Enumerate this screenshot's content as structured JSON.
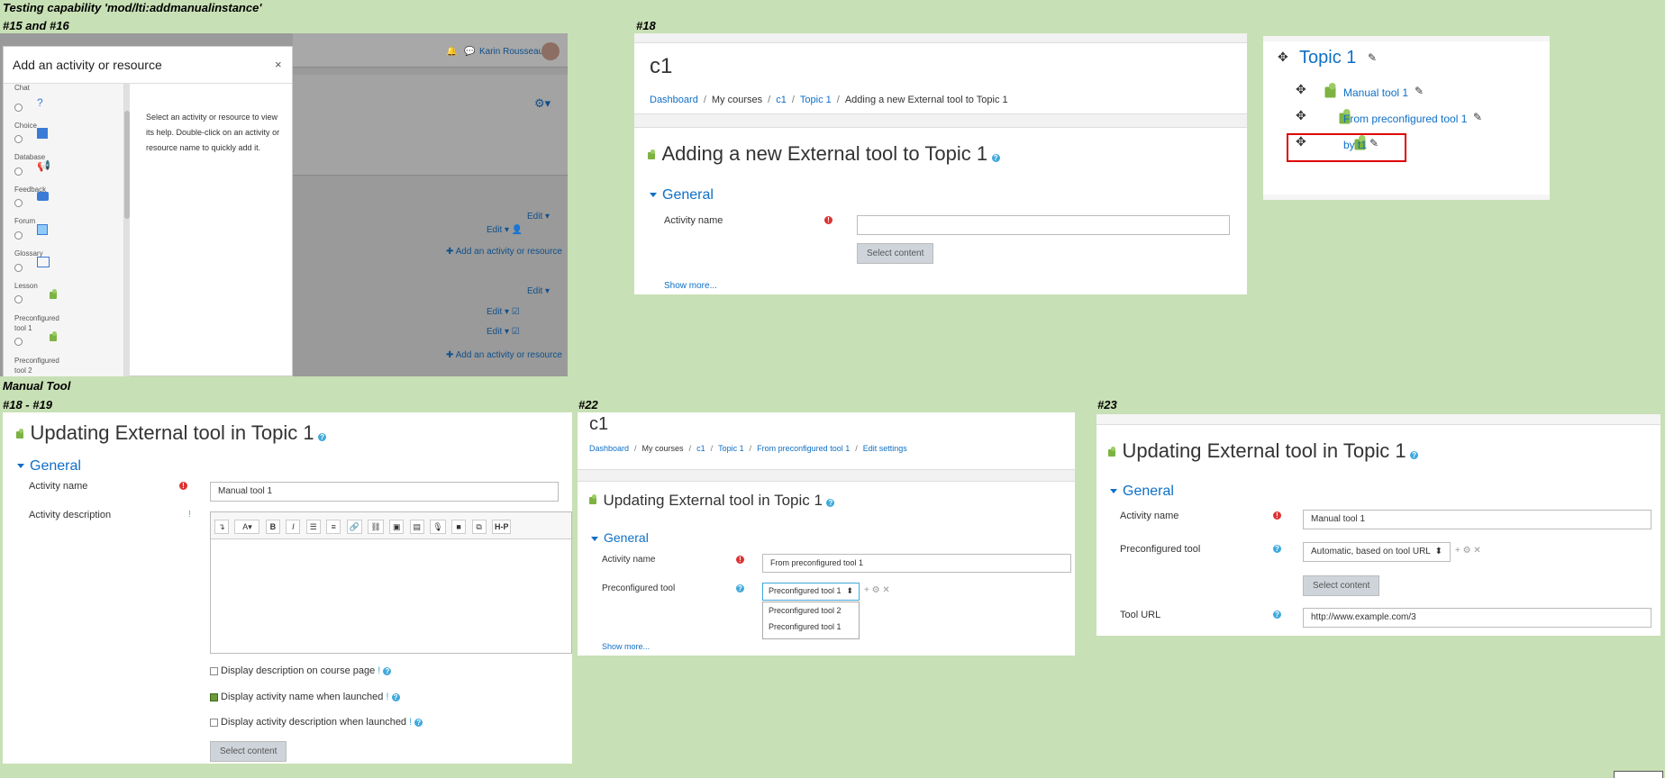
{
  "labels": {
    "testing": "Testing capability 'mod/lti:addmanualinstance'",
    "s15": "#15 and #16",
    "s18a": "#18",
    "manual": "Manual Tool",
    "s1819": "#18 - #19",
    "s22": "#22",
    "s23": "#23"
  },
  "p1": {
    "user": "Karin Rousseau",
    "modal_title": "Add an activity or resource",
    "close": "×",
    "help_text": "Select an activity or resource to view its help. Double-click on an activity or resource name to quickly add it.",
    "items": [
      {
        "name": "Chat"
      },
      {
        "name": "Choice"
      },
      {
        "name": "Database"
      },
      {
        "name": "Feedback"
      },
      {
        "name": "Forum"
      },
      {
        "name": "Glossary"
      },
      {
        "name": "Lesson"
      },
      {
        "name": "Preconfigured tool 1"
      },
      {
        "name": "Preconfigured tool 2"
      }
    ],
    "edit": "Edit",
    "add_activity": "Add an activity or resource"
  },
  "p2": {
    "course": "c1",
    "crumbs": [
      "Dashboard",
      "My courses",
      "c1",
      "Topic 1",
      "Adding a new External tool to Topic 1"
    ],
    "heading": "Adding a new External tool to Topic 1",
    "general": "General",
    "activity_name": "Activity name",
    "select_content": "Select content",
    "show_more": "Show more..."
  },
  "p3": {
    "topic": "Topic 1",
    "items": [
      "Manual tool 1",
      "From preconfigured tool 1",
      "by t1"
    ]
  },
  "p4": {
    "heading": "Updating External tool in Topic 1",
    "general": "General",
    "activity_name": "Activity name",
    "name_value": "Manual tool 1",
    "activity_description": "Activity description",
    "cb1": "Display description on course page",
    "cb2": "Display activity name when launched",
    "cb3": "Display activity description when launched",
    "select_content": "Select content"
  },
  "p5": {
    "course": "c1",
    "crumbs": [
      "Dashboard",
      "My courses",
      "c1",
      "Topic 1",
      "From preconfigured tool 1",
      "Edit settings"
    ],
    "heading": "Updating External tool in Topic 1",
    "general": "General",
    "activity_name": "Activity name",
    "name_value": "From preconfigured tool 1",
    "preconfigured": "Preconfigured tool",
    "selected": "Preconfigured tool 1",
    "options": [
      "Preconfigured tool 2",
      "Preconfigured tool 1"
    ],
    "show_more": "Show more..."
  },
  "p6": {
    "heading": "Updating External tool in Topic 1",
    "general": "General",
    "activity_name": "Activity name",
    "name_value": "Manual tool 1",
    "preconfigured": "Preconfigured tool",
    "selected": "Automatic, based on tool URL",
    "select_content": "Select content",
    "tool_url": "Tool URL",
    "url_value": "http://www.example.com/3"
  },
  "colors": {
    "accent": "#0f6fc5",
    "background": "#c8e0b5",
    "highlight": "#e00000"
  }
}
